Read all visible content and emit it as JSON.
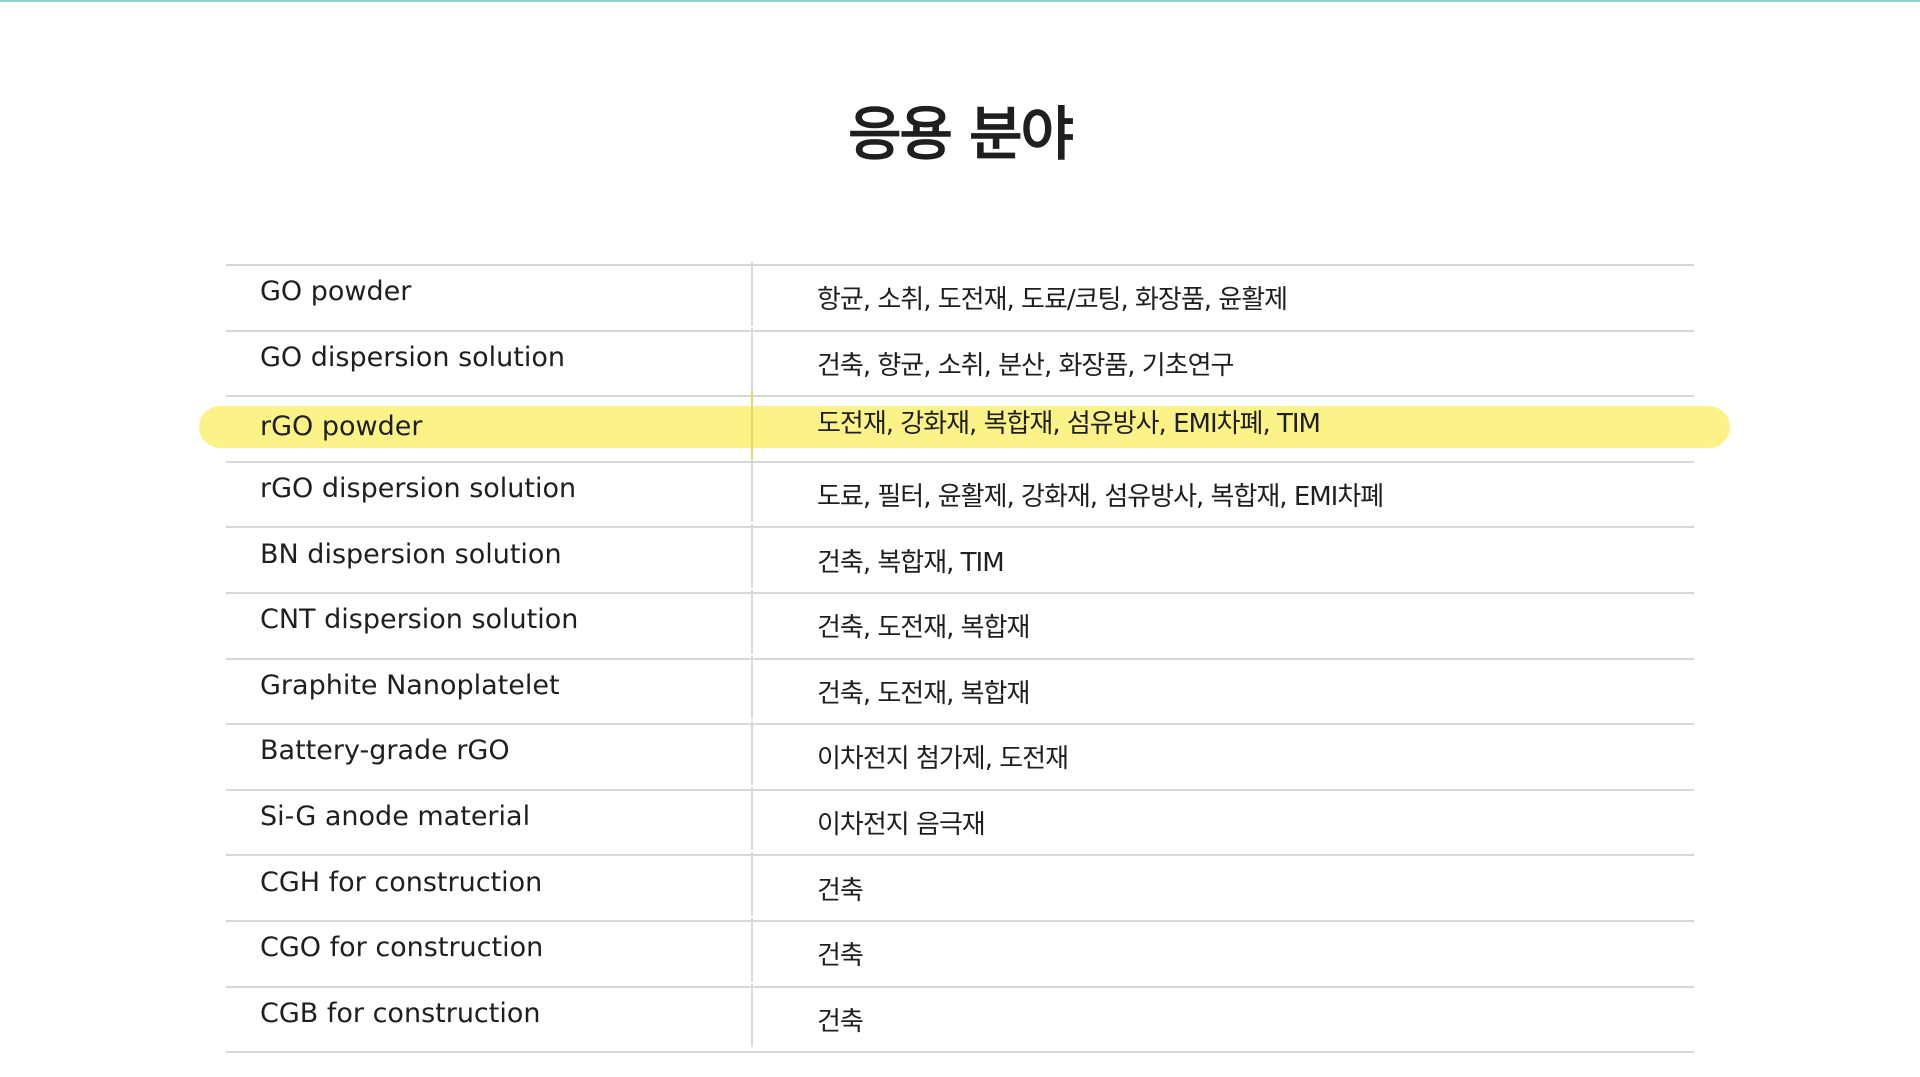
{
  "page": {
    "title": "응용 분야"
  },
  "table": {
    "rows": [
      {
        "product": "GO powder",
        "uses": "항균, 소취, 도전재, 도료/코팅, 화장품, 윤활제",
        "highlight": false
      },
      {
        "product": "GO dispersion solution",
        "uses": "건축, 향균, 소취, 분산, 화장품, 기초연구",
        "highlight": false
      },
      {
        "product": "rGO powder",
        "uses": "도전재, 강화재, 복합재, 섬유방사, EMI차폐, TIM",
        "highlight": true
      },
      {
        "product": "rGO dispersion solution",
        "uses": "도료, 필터, 윤활제, 강화재, 섬유방사, 복합재, EMI차폐",
        "highlight": false
      },
      {
        "product": "BN dispersion solution",
        "uses": "건축, 복합재, TIM",
        "highlight": false
      },
      {
        "product": "CNT dispersion solution",
        "uses": "건축, 도전재, 복합재",
        "highlight": false
      },
      {
        "product": "Graphite Nanoplatelet",
        "uses": "건축, 도전재, 복합재",
        "highlight": false
      },
      {
        "product": "Battery-grade rGO",
        "uses": "이차전지 첨가제, 도전재",
        "highlight": false
      },
      {
        "product": "Si-G anode material",
        "uses": "이차전지 음극재",
        "highlight": false
      },
      {
        "product": "CGH for construction",
        "uses": "건축",
        "highlight": false
      },
      {
        "product": "CGO for construction",
        "uses": "건축",
        "highlight": false
      },
      {
        "product": "CGB for construction",
        "uses": "건축",
        "highlight": false
      }
    ]
  },
  "colors": {
    "highlight": "#fbf388",
    "rule": "#d9d9d9",
    "text": "#1f1f1f",
    "top_accent": "#8fd3d3"
  }
}
